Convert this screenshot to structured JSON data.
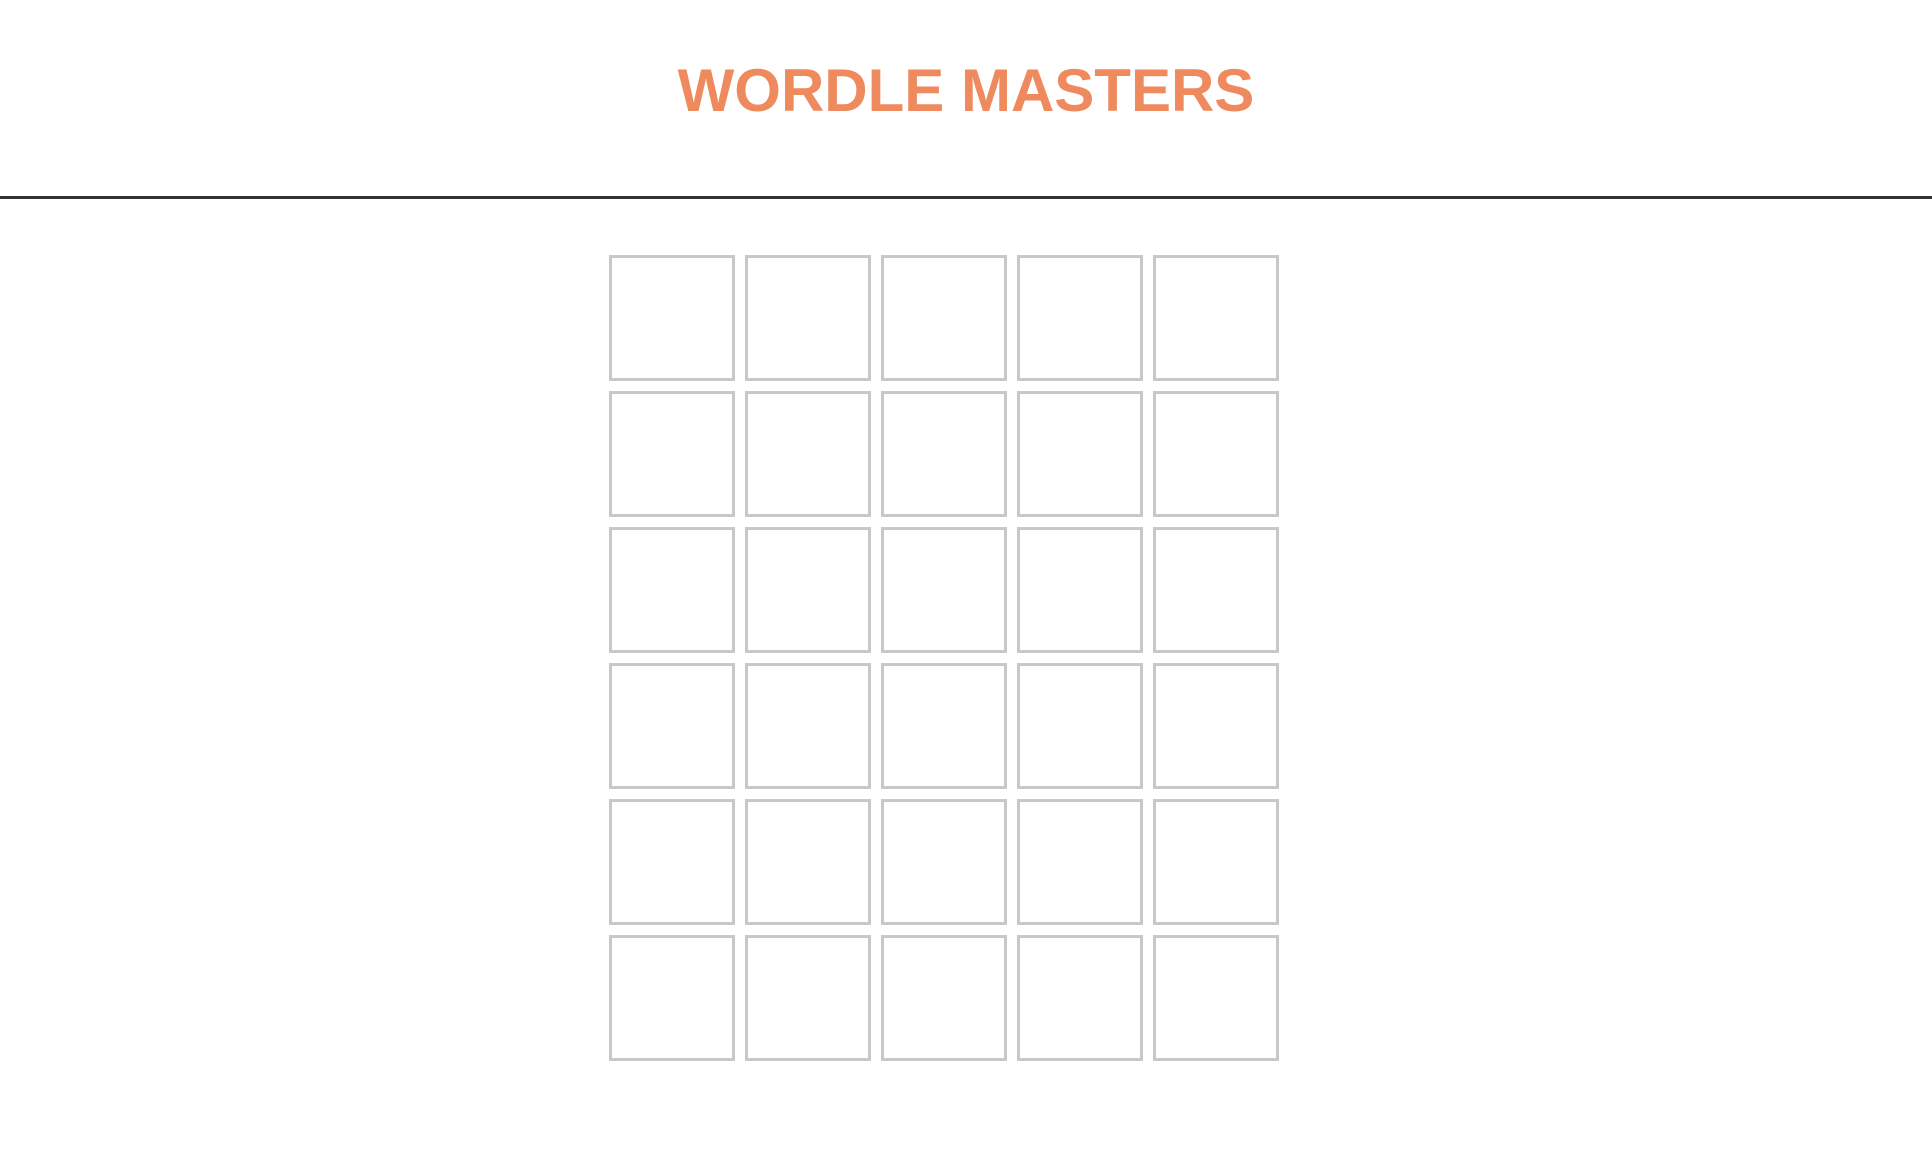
{
  "header": {
    "title": "WORDLE MASTERS"
  },
  "colors": {
    "title": "#EE8A5E",
    "tile_border": "#C8C8C8",
    "divider": "#333333",
    "background": "#FFFFFF"
  },
  "board": {
    "rows": [
      [
        "",
        "",
        "",
        "",
        ""
      ],
      [
        "",
        "",
        "",
        "",
        ""
      ],
      [
        "",
        "",
        "",
        "",
        ""
      ],
      [
        "",
        "",
        "",
        "",
        ""
      ],
      [
        "",
        "",
        "",
        "",
        ""
      ],
      [
        "",
        "",
        "",
        "",
        ""
      ]
    ]
  }
}
